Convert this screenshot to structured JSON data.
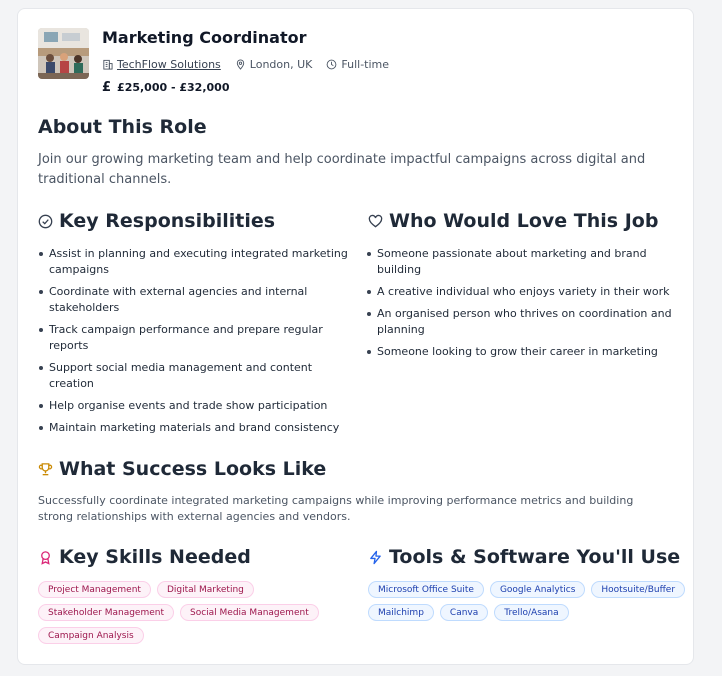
{
  "job": {
    "title": "Marketing Coordinator",
    "company": "TechFlow Solutions",
    "location": "London, UK",
    "type": "Full-time",
    "salary": "£25,000 - £32,000",
    "salary_icon": "£"
  },
  "about": {
    "heading": "About This Role",
    "text": "Join our growing marketing team and help coordinate impactful campaigns across digital and traditional channels."
  },
  "responsibilities": {
    "heading": "Key Responsibilities",
    "items": [
      "Assist in planning and executing integrated marketing campaigns",
      "Coordinate with external agencies and internal stakeholders",
      "Track campaign performance and prepare regular reports",
      "Support social media management and content creation",
      "Help organise events and trade show participation",
      "Maintain marketing materials and brand consistency"
    ]
  },
  "who": {
    "heading": "Who Would Love This Job",
    "items": [
      "Someone passionate about marketing and brand building",
      "A creative individual who enjoys variety in their work",
      "An organised person who thrives on coordination and planning",
      "Someone looking to grow their career in marketing"
    ]
  },
  "success": {
    "heading": "What Success Looks Like",
    "text": "Successfully coordinate integrated marketing campaigns while improving performance metrics and building strong relationships with external agencies and vendors."
  },
  "skills": {
    "heading": "Key Skills Needed",
    "tags": [
      "Project Management",
      "Digital Marketing",
      "Stakeholder Management",
      "Social Media Management",
      "Campaign Analysis"
    ]
  },
  "tools": {
    "heading": "Tools & Software You'll Use",
    "tags": [
      "Microsoft Office Suite",
      "Google Analytics",
      "Hootsuite/Buffer",
      "Mailchimp",
      "Canva",
      "Trello/Asana"
    ]
  },
  "colors": {
    "skill_tag": "#fdf2f8",
    "tool_tag": "#eff6ff",
    "skills_icon": "#db2777",
    "tools_icon": "#2563eb",
    "success_icon": "#ca8a04"
  }
}
